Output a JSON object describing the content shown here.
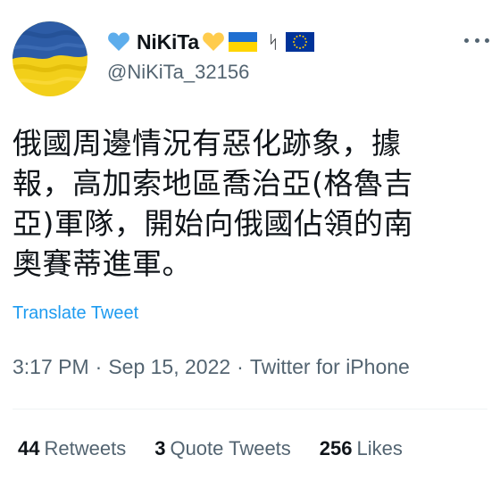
{
  "author": {
    "display_name": "NiKiTa",
    "handle": "@NiKiTa_32156",
    "name_emojis": [
      "blue-heart-icon",
      "yellow-heart-icon",
      "ukraine-flag-icon",
      "rune-icon",
      "eu-flag-icon"
    ],
    "rune_glyph": "ᛋ"
  },
  "tweet": {
    "text": "俄國周邊情況有惡化跡象，據\n報，高加索地區喬治亞(格魯吉\n亞)軍隊，開始向俄國佔領的南\n奧賽蒂進軍。",
    "translate_label": "Translate Tweet",
    "time": "3:17 PM",
    "date": "Sep 15, 2022",
    "source": "Twitter for iPhone",
    "separator": "·"
  },
  "stats": {
    "retweets_count": "44",
    "retweets_label": "Retweets",
    "quotes_count": "3",
    "quotes_label": "Quote Tweets",
    "likes_count": "256",
    "likes_label": "Likes"
  },
  "colors": {
    "accent": "#1d9bf0",
    "secondary_text": "#536471",
    "ukraine_blue": "#2f5fa8",
    "ukraine_yellow": "#f5d000"
  }
}
